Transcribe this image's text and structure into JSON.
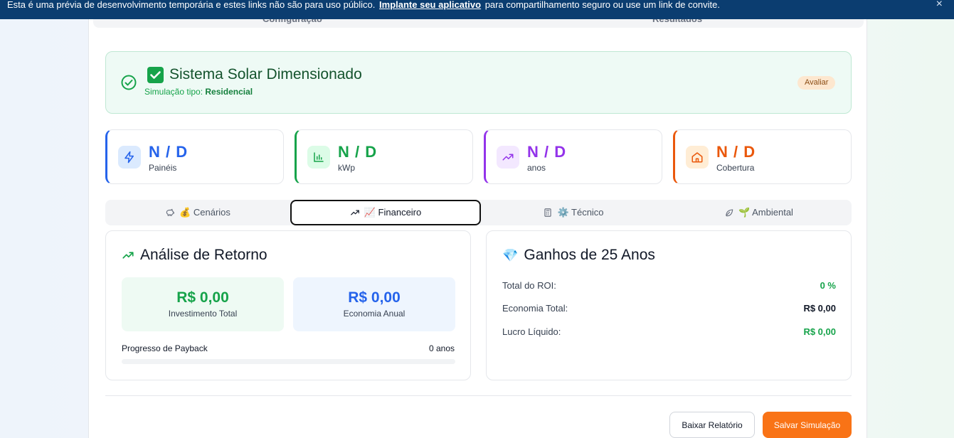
{
  "banner": {
    "text_before": "Esta é uma prévia de desenvolvimento temporária e estes links não são para uso público.",
    "link": "Implante seu aplicativo",
    "text_after": "para compartilhamento seguro ou use um link de convite.",
    "close": "×"
  },
  "top_tabs": [
    "Configuração",
    "Resultados"
  ],
  "success": {
    "title": "Sistema Solar Dimensionado",
    "subtitle_prefix": "Simulação tipo:",
    "subtitle_value": "Residencial",
    "badge": "Avaliar"
  },
  "stats": [
    {
      "value": "N / D",
      "label": "Painéis",
      "color": "#2563eb",
      "icon": "zap-icon"
    },
    {
      "value": "N / D",
      "label": "kWp",
      "color": "#16a34a",
      "icon": "bar-chart-icon"
    },
    {
      "value": "N / D",
      "label": "anos",
      "color": "#9333ea",
      "icon": "trending-up-icon"
    },
    {
      "value": "N / D",
      "label": "Cobertura",
      "color": "#ea580c",
      "icon": "home-icon"
    }
  ],
  "subtabs": [
    {
      "label": "💰 Cenários",
      "icon": "piggy-bank-icon"
    },
    {
      "label": "📈 Financeiro",
      "icon": "trending-up-icon"
    },
    {
      "label": "⚙️ Técnico",
      "icon": "calculator-icon"
    },
    {
      "label": "🌱 Ambiental",
      "icon": "leaf-icon"
    }
  ],
  "return_analysis": {
    "title": "Análise de Retorno",
    "investment_value": "R$ 0,00",
    "investment_label": "Investimento Total",
    "savings_value": "R$ 0,00",
    "savings_label": "Economia Anual",
    "payback_label": "Progresso de Payback",
    "payback_value": "0 anos",
    "payback_progress": 0
  },
  "gains": {
    "emoji": "💎",
    "title": "Ganhos de 25 Anos",
    "rows": [
      {
        "label": "Total do ROI:",
        "value": "0 %",
        "color": "#16a34a"
      },
      {
        "label": "Economia Total:",
        "value": "R$ 0,00",
        "color": "#111827"
      },
      {
        "label": "Lucro Líquido:",
        "value": "R$ 0,00",
        "color": "#16a34a"
      }
    ]
  },
  "actions": {
    "download": "Baixar Relatório",
    "save": "Salvar Simulação"
  }
}
